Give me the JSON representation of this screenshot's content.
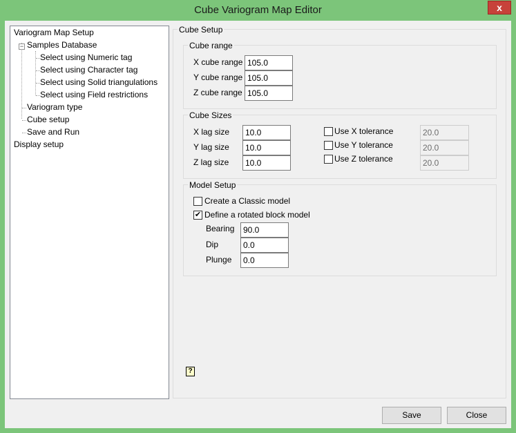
{
  "window": {
    "title": "Cube Variogram Map Editor",
    "close_glyph": "x"
  },
  "tree": {
    "root": "Variogram Map Setup",
    "samples_db": "Samples Database",
    "expander_glyph": "−",
    "sub": [
      "Select using Numeric tag",
      "Select using Character tag",
      "Select using Solid triangulations",
      "Select using Field restrictions"
    ],
    "variogram_type": "Variogram type",
    "cube_setup": "Cube setup",
    "save_run": "Save and Run",
    "display_setup": "Display setup"
  },
  "cube_setup": {
    "legend": "Cube Setup",
    "cube_range": {
      "legend": "Cube range",
      "x_label": "X cube range",
      "x_value": "105.0",
      "y_label": "Y cube range",
      "y_value": "105.0",
      "z_label": "Z cube range",
      "z_value": "105.0"
    },
    "cube_sizes": {
      "legend": "Cube Sizes",
      "x_label": "X lag size",
      "x_value": "10.0",
      "y_label": "Y lag size",
      "y_value": "10.0",
      "z_label": "Z lag size",
      "z_value": "10.0",
      "x_tol_label": "Use X tolerance",
      "x_tol_value": "20.0",
      "x_tol_checked": false,
      "y_tol_label": "Use Y tolerance",
      "y_tol_value": "20.0",
      "y_tol_checked": false,
      "z_tol_label": "Use Z tolerance",
      "z_tol_value": "20.0",
      "z_tol_checked": false
    },
    "model_setup": {
      "legend": "Model Setup",
      "classic_label": "Create a Classic model",
      "classic_checked": false,
      "rotated_label": "Define a rotated block model",
      "rotated_checked": true,
      "check_glyph": "✔",
      "bearing_label": "Bearing",
      "bearing_value": "90.0",
      "dip_label": "Dip",
      "dip_value": "0.0",
      "plunge_label": "Plunge",
      "plunge_value": "0.0"
    }
  },
  "help_glyph": "?",
  "buttons": {
    "save": "Save",
    "close": "Close"
  }
}
